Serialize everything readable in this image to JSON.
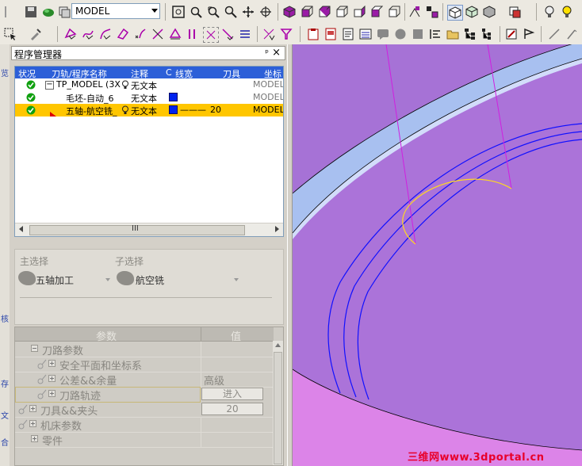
{
  "toolbar": {
    "model_select": "MODEL"
  },
  "panel": {
    "title": "程序管理器",
    "pin_glyph": "ᵖ",
    "close_glyph": "×"
  },
  "tree": {
    "headers": [
      "状况",
      "刀轨/程序名称",
      "注释",
      "C",
      "线宽",
      "刀具",
      "坐标"
    ],
    "rows": [
      {
        "name": "TP_MODEL (3X",
        "comment": "无文本",
        "linewidth": "",
        "tool": "",
        "coord": "MODEL",
        "selected": false,
        "expander": "−"
      },
      {
        "name": "毛坯-自动_6",
        "comment": "无文本",
        "linewidth": "",
        "tool": "",
        "coord": "MODEL",
        "selected": false,
        "expander": ""
      },
      {
        "name": "五轴-航空铣_",
        "comment": "无文本",
        "linewidth": "———",
        "tool": "20",
        "coord": "MODEL",
        "selected": true,
        "expander": ""
      }
    ],
    "scroll_grip": "III"
  },
  "selection": {
    "main_label": "主选择",
    "main_value": "五轴加工",
    "sub_label": "子选择",
    "sub_value": "航空铣"
  },
  "params": {
    "col_param": "参数",
    "col_value": "值",
    "rows": [
      {
        "name": "刀路参数",
        "value": "",
        "indent": 1
      },
      {
        "name": "安全平面和坐标系",
        "value": "",
        "indent": 2
      },
      {
        "name": "公差&&余量",
        "value": "高级",
        "indent": 2
      },
      {
        "name": "刀路轨迹",
        "value": "进入",
        "indent": 2,
        "button": true
      },
      {
        "name": "刀具&&夹头",
        "value": "20",
        "indent": 0,
        "button": true
      },
      {
        "name": "机床参数",
        "value": "",
        "indent": 0
      },
      {
        "name": "零件",
        "value": "",
        "indent": 1
      }
    ]
  },
  "left_strip": {
    "chars": [
      "览",
      "核",
      "存",
      "文",
      "合"
    ]
  },
  "watermark": "三维网www.3dportal.cn",
  "colors": {
    "viewport_bg": "#a872d8",
    "selection_row": "#ffc600",
    "tree_header": "#2c5fd8",
    "toolpath_blue": "#1010ff",
    "toolpath_magenta": "#d020e0",
    "toolpath_yellow": "#ffd820"
  }
}
